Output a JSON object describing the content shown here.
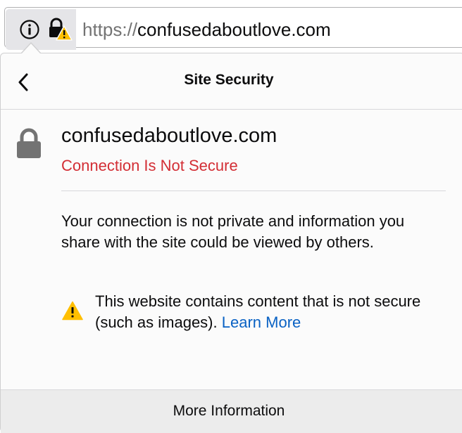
{
  "urlbar": {
    "scheme": "https://",
    "host": "confusedaboutlove.com",
    "identity_icons": [
      "info-icon",
      "lock-warning-icon"
    ]
  },
  "panel": {
    "title": "Site Security",
    "back_icon": "chevron-left-icon",
    "site_host": "confusedaboutlove.com",
    "connection_status": "Connection Is Not Secure",
    "description": "Your connection is not private and information you share with the site could be viewed by others.",
    "mixed_content_text": "This website contains content that is not secure (such as images).",
    "learn_more": "Learn More",
    "more_info_button": "More Information"
  },
  "colors": {
    "insecure_red": "#d32e35",
    "link_blue": "#0a62c4",
    "warning_yellow": "#ffbf00",
    "panel_bg": "#fbfbfb",
    "footer_bg": "#ececec",
    "identity_bg": "#e5e5e8"
  }
}
